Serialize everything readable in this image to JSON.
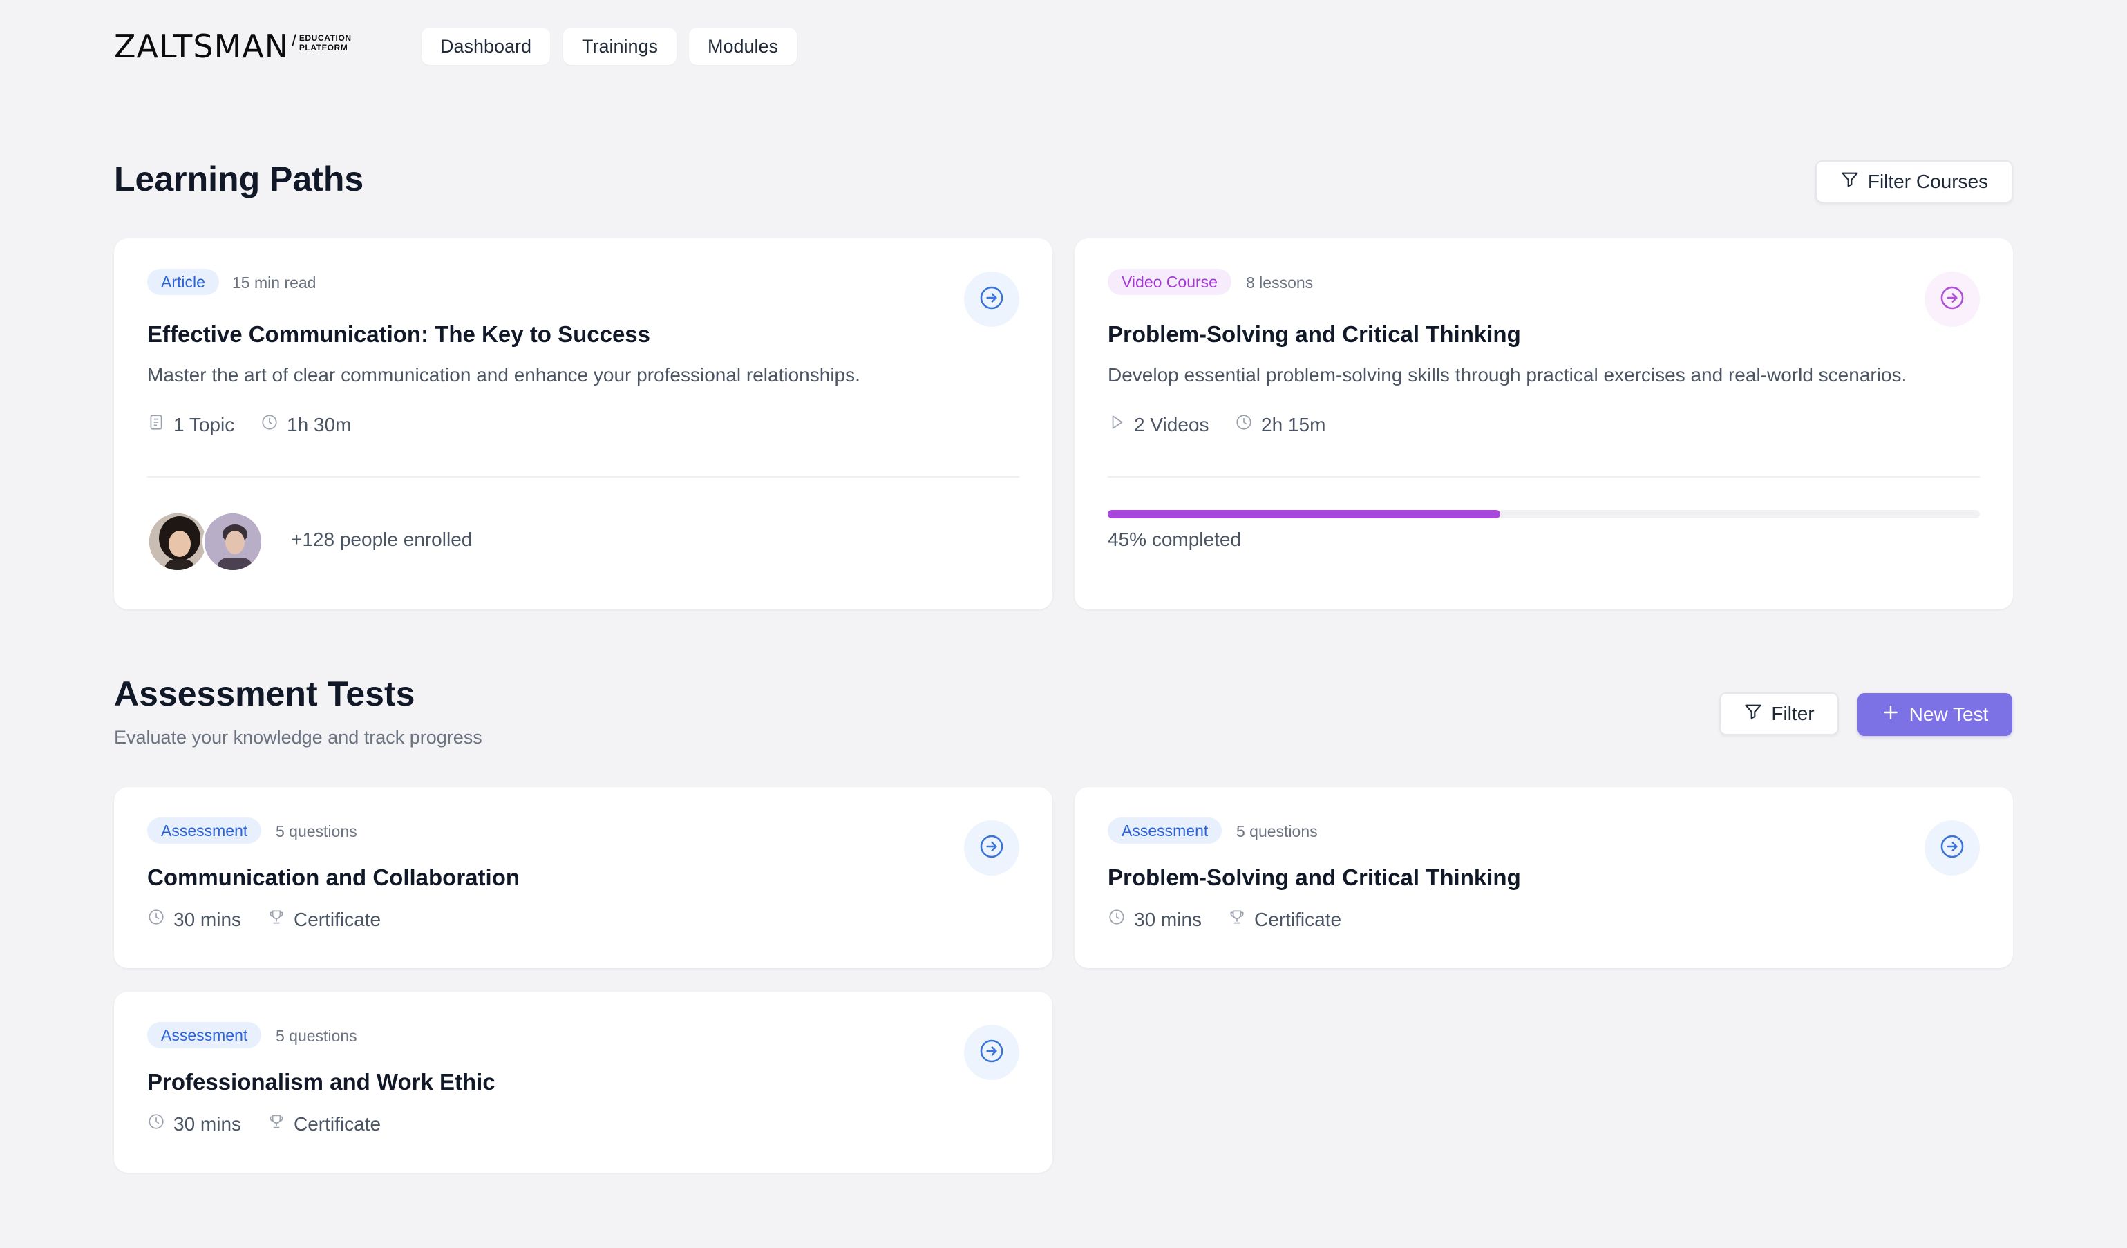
{
  "header": {
    "logo_text": "ZALTSMAN",
    "logo_sub_1": "EDUCATION",
    "logo_sub_2": "PLATFORM",
    "nav": [
      "Dashboard",
      "Trainings",
      "Modules"
    ]
  },
  "learning_paths": {
    "title": "Learning Paths",
    "filter_label": "Filter Courses",
    "cards": [
      {
        "badge": "Article",
        "meta": "15 min read",
        "title": "Effective Communication: The Key to Success",
        "description": "Master the art of clear communication and enhance your professional relationships.",
        "stat1": "1 Topic",
        "stat2": "1h 30m",
        "enrolled": "+128 people enrolled"
      },
      {
        "badge": "Video Course",
        "meta": "8 lessons",
        "title": "Problem-Solving and Critical Thinking",
        "description": "Develop essential problem-solving skills through practical exercises and real-world scenarios.",
        "stat1": "2 Videos",
        "stat2": "2h 15m",
        "progress": 0.45,
        "progress_label": "45% completed"
      }
    ]
  },
  "assessments": {
    "title": "Assessment Tests",
    "subtitle": "Evaluate your knowledge and track progress",
    "filter_label": "Filter",
    "new_label": "New Test",
    "cards": [
      {
        "badge": "Assessment",
        "meta": "5 questions",
        "title": "Communication and Collaboration",
        "duration": "30 mins",
        "reward": "Certificate"
      },
      {
        "badge": "Assessment",
        "meta": "5 questions",
        "title": "Problem-Solving and Critical Thinking",
        "duration": "30 mins",
        "reward": "Certificate"
      },
      {
        "badge": "Assessment",
        "meta": "5 questions",
        "title": "Professionalism and Work Ethic",
        "duration": "30 mins",
        "reward": "Certificate"
      }
    ]
  },
  "colors": {
    "accent": "#7c72e6",
    "badge_blue": "#2b63d6",
    "badge_purple": "#a23ad1",
    "progress": "#a747dc"
  },
  "icons": [
    "filter-icon",
    "plus-icon",
    "arrow-right-circle-icon",
    "document-icon",
    "clock-icon",
    "play-icon",
    "trophy-icon"
  ]
}
